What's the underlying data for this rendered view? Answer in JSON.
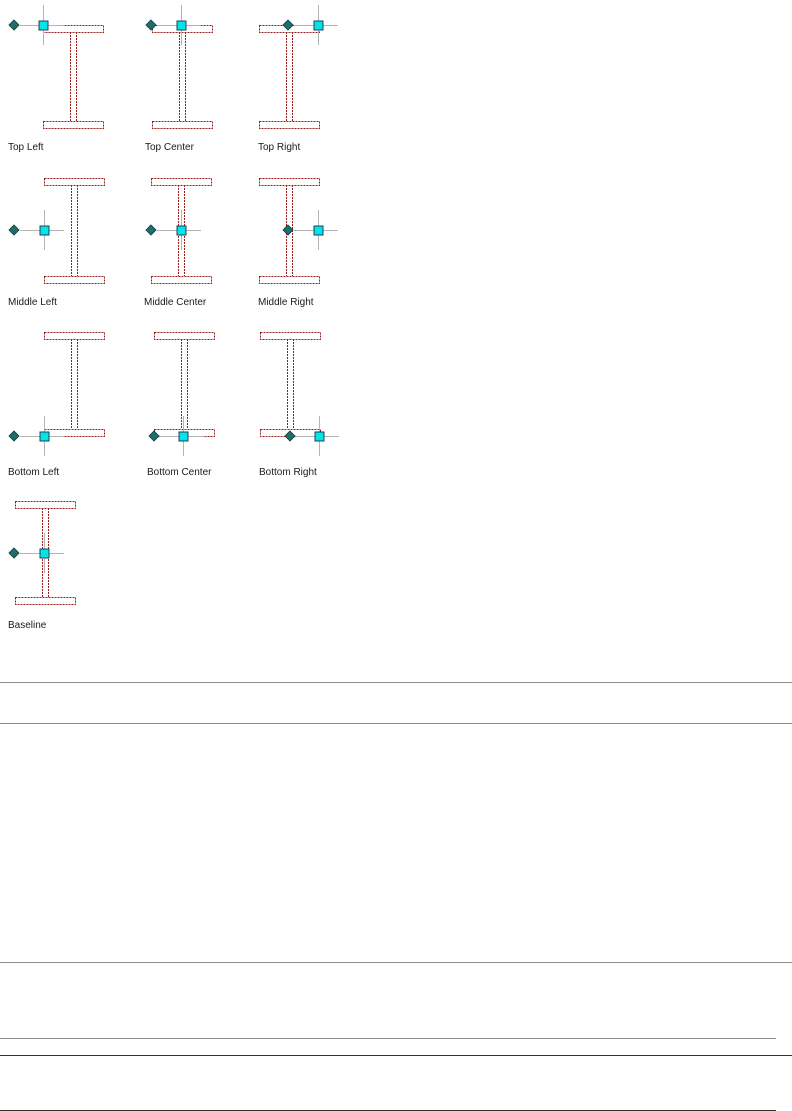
{
  "colors": {
    "section_outline": "#9b1b1b",
    "insertion_point": "#00e6e6",
    "grip": "#1f6e6e",
    "crosshair": "#b4b4b4",
    "rule_gray": "#8c8c8c",
    "rule_dark": "#333333"
  },
  "icons": {
    "insertion_point": "square-grip-icon",
    "grip": "diamond-grip-icon",
    "section": "i-beam-section-icon"
  },
  "diagrams": [
    {
      "label": "Top Left"
    },
    {
      "label": "Top Center"
    },
    {
      "label": "Top Right"
    },
    {
      "label": "Middle Left"
    },
    {
      "label": "Middle Center"
    },
    {
      "label": "Middle Right"
    },
    {
      "label": "Bottom Left"
    },
    {
      "label": "Bottom Center"
    },
    {
      "label": "Bottom Right"
    },
    {
      "label": "Baseline"
    }
  ]
}
